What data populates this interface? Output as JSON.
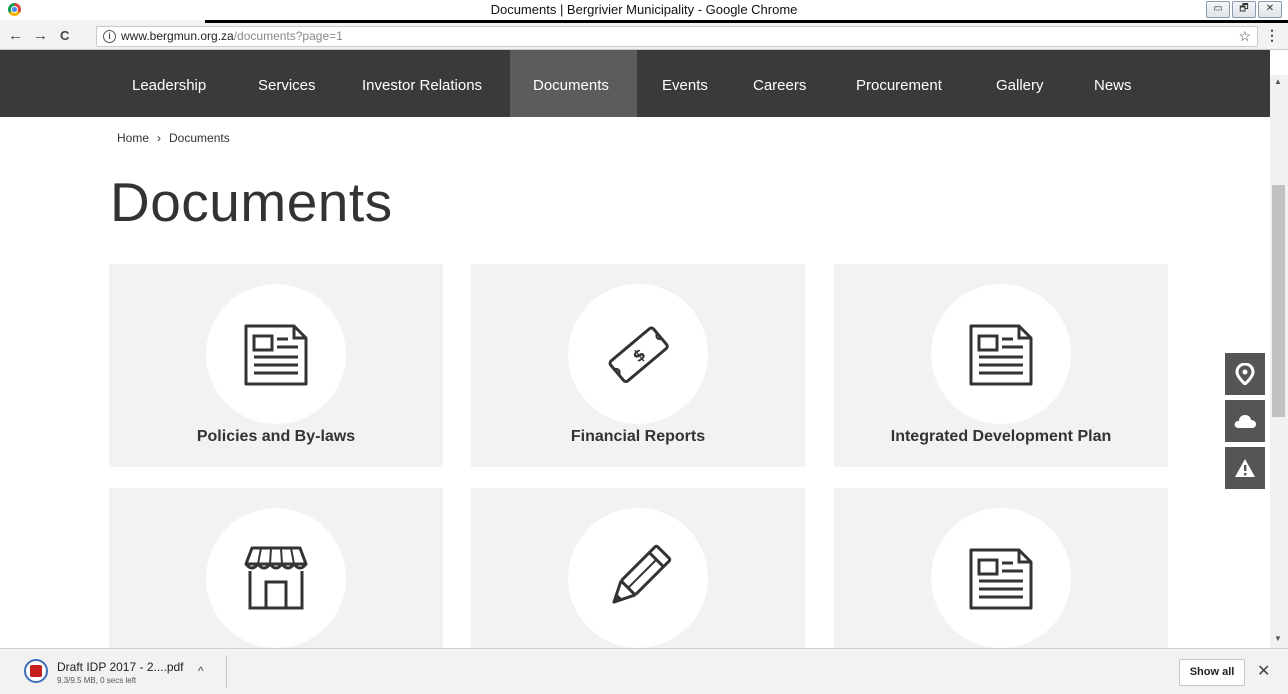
{
  "window": {
    "title": "Documents | Bergrivier Municipality - Google Chrome",
    "buttons": {
      "minimize": "▭",
      "restore": "🗗",
      "close": "✕"
    }
  },
  "browser": {
    "url_host": "www.bergmun.org.za",
    "url_path": "/documents?page=1",
    "back_icon": "←",
    "forward_icon": "→",
    "reload_icon": "C",
    "info_icon": "i",
    "star_icon": "☆",
    "menu_icon": "⋮"
  },
  "nav": {
    "items": [
      "Leadership",
      "Services",
      "Investor Relations",
      "Documents",
      "Events",
      "Careers",
      "Procurement",
      "Gallery",
      "News"
    ],
    "active": "Documents"
  },
  "breadcrumb": {
    "home": "Home",
    "separator": "›",
    "current": "Documents"
  },
  "page_title": "Documents",
  "cards": [
    {
      "label": "Policies and By-laws",
      "icon": "newspaper-icon"
    },
    {
      "label": "Financial Reports",
      "icon": "money-note-icon"
    },
    {
      "label": "Integrated Development Plan",
      "icon": "newspaper-icon"
    },
    {
      "label": "",
      "icon": "shop-icon"
    },
    {
      "label": "",
      "icon": "pencil-icon"
    },
    {
      "label": "",
      "icon": "newspaper-icon"
    }
  ],
  "side_widgets": [
    "location-pin-icon",
    "cloud-icon",
    "warning-icon"
  ],
  "download": {
    "filename": "Draft IDP 2017 - 2....pdf",
    "progress": "9.3/9.5 MB, 0 secs left",
    "caret": "^",
    "show_all": "Show all",
    "close": "✕"
  },
  "colors": {
    "nav_bg": "#3a3a3a",
    "nav_active_bg": "#5c5c5c",
    "card_bg": "#f2f2f2",
    "text": "#333333",
    "side_widget_bg": "#555555"
  }
}
